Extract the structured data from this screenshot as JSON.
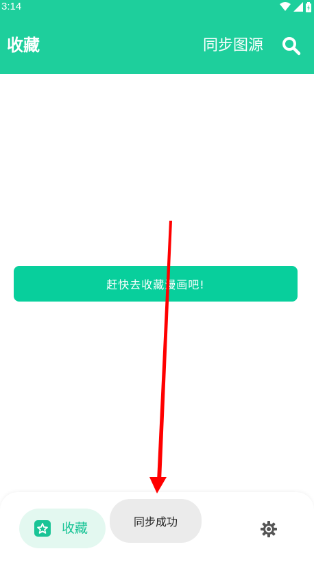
{
  "status_bar": {
    "time": "3:14",
    "icons": [
      "wifi-icon",
      "signal-icon",
      "battery-charging-icon"
    ]
  },
  "app_bar": {
    "title": "收藏",
    "sync_label": "同步图源",
    "search_icon": "search-icon"
  },
  "main": {
    "empty_button_label": "赶快去收藏漫画吧!"
  },
  "bottom_nav": {
    "items": [
      {
        "label": "收藏",
        "icon": "favorite-icon",
        "selected": true
      },
      {
        "label": "",
        "icon": "explore-icon",
        "selected": false
      },
      {
        "label": "",
        "icon": "settings-gear-icon",
        "selected": false
      }
    ]
  },
  "toast": {
    "text": "同步成功"
  },
  "colors": {
    "primary": "#1ecf9c",
    "button": "#08cf9c",
    "nav_selected_bg": "#e3f8f0",
    "annotation_arrow": "#ff0000"
  }
}
